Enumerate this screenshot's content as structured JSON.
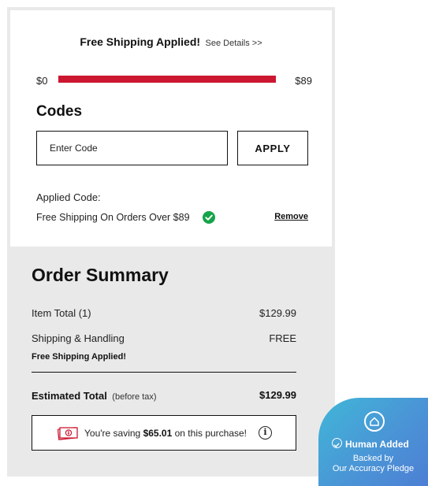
{
  "shipping_banner": {
    "title": "Free Shipping Applied!",
    "details_link": "See Details >>"
  },
  "progress": {
    "min_label": "$0",
    "max_label": "$89",
    "fill_fraction": 1.0,
    "fill_color": "#cc1731"
  },
  "codes": {
    "title": "Codes",
    "input_placeholder": "Enter Code",
    "input_value": "",
    "apply_label": "APPLY",
    "applied_label": "Applied Code:",
    "applied_code": "Free Shipping On Orders Over $89",
    "applied_status_icon": "check-circle-icon",
    "remove_label": "Remove"
  },
  "summary": {
    "title": "Order Summary",
    "item_total_label": "Item Total (1)",
    "item_total_value": "$129.99",
    "shipping_label": "Shipping & Handling",
    "shipping_value": "FREE",
    "shipping_note": "Free Shipping Applied!",
    "estimated_total_label": "Estimated Total",
    "estimated_total_note": "(before tax)",
    "estimated_total_value": "$129.99"
  },
  "savings": {
    "prefix": "You're saving",
    "amount": "$65.01",
    "suffix": "on this purchase!",
    "info_glyph": "i"
  },
  "badge": {
    "title": "Human Added",
    "line1": "Backed by",
    "line2": "Our Accuracy Pledge"
  },
  "colors": {
    "accent_red": "#cc1731",
    "success_green": "#16a34a",
    "summary_bg": "#e9e9e9",
    "badge_gradient_start": "#40b7d8",
    "badge_gradient_end": "#4d7fd4"
  }
}
